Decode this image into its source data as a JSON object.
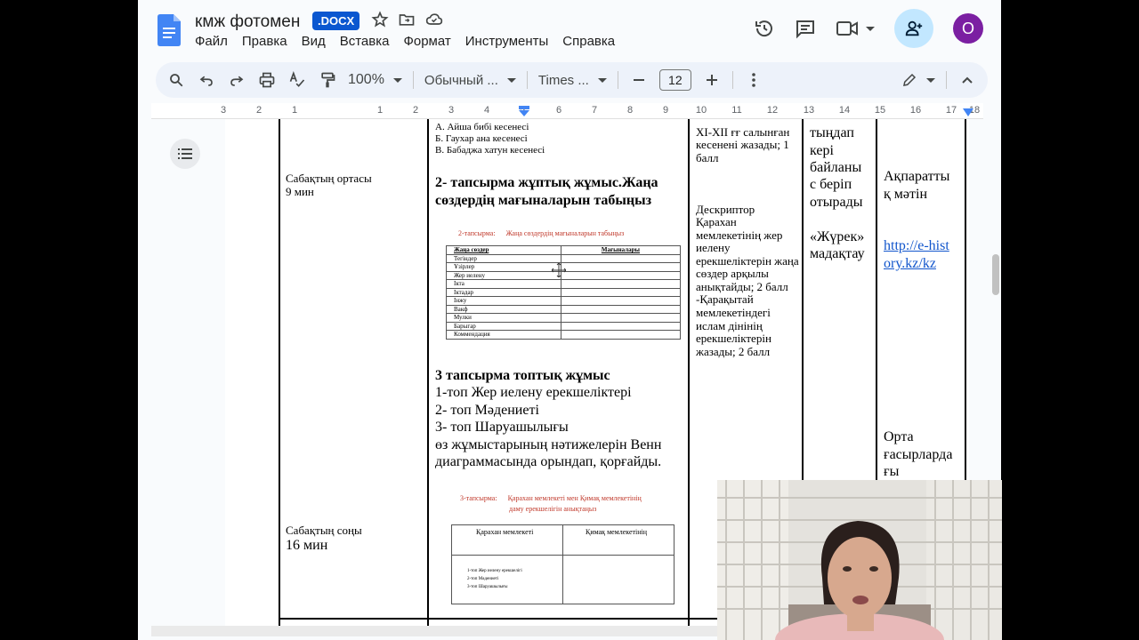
{
  "header": {
    "title": "кмж фотомен",
    "badge": ".DOCX"
  },
  "menu": [
    "Файл",
    "Правка",
    "Вид",
    "Вставка",
    "Формат",
    "Инструменты",
    "Справка"
  ],
  "toolbar": {
    "zoom": "100%",
    "style": "Обычный ...",
    "font": "Times ...",
    "font_size": "12"
  },
  "ruler": [
    "3",
    "2",
    "1",
    "1",
    "2",
    "3",
    "4",
    "5",
    "6",
    "7",
    "8",
    "9",
    "10",
    "11",
    "12",
    "13",
    "14",
    "15",
    "16",
    "17",
    "18"
  ],
  "avatar_letter": "O",
  "doc": {
    "col1": {
      "mid_label": "Сабақтың ортасы",
      "mid_time": "9 мин",
      "end_label": "Сабақтың соңы",
      "end_time": "16 мин"
    },
    "col2": {
      "opt_a": "А. Айша бибі кесенесі",
      "opt_b": "Б. Гаухар ана кесенесі",
      "opt_c": "В. Бабаджа хатун кесенесі",
      "task2_line1": "2- тапсырма жұптық жұмыс.Жаңа",
      "task2_line2": "сөздердің мағыналарын табыңыз",
      "mini_caption_label": "2-тапсырма:",
      "mini_caption_text": "Жаңа сөздердің мағыналарын табыңыз",
      "mini_table_headers": [
        "Жаңа сөздер",
        "Мағыналары"
      ],
      "mini_table_rows": [
        "Тегіндер",
        "Ұзірлер",
        "Жер иелену",
        "Iкта",
        "Iктадар",
        "Iнжу",
        "Вакф",
        "Мулки",
        "Барыгар",
        "Коммендация"
      ],
      "task3_title": "3 тапсырма топтық жұмыс",
      "task3_lines": [
        "1-топ Жер иелену ерекшеліктері",
        "2- топ Мәдениеті",
        "3- топ Шаруашылығы",
        "өз жұмыстарының нәтижелерін Венн",
        "диаграммасында орындап, қорғайды."
      ],
      "venn_caption_label": "3-тапсырма:",
      "venn_caption_line1": "Қарахан мемлекеті мен Қимақ мемлекетінің",
      "venn_caption_line2": "даму ерекшелігін анықтаңыз",
      "venn_left": "Қарахан мемлекеті",
      "venn_right": "Қимақ мемлекетінің",
      "venn_items": [
        "1-топ Жер иелену ерекшелігі",
        "2-топ Мәдениеті",
        "3-топ Шаруашылығы"
      ]
    },
    "col3": {
      "top_line1": "XI-XII ғғ салынған",
      "top_line2": "кесенені жазады; 1",
      "top_line3": "балл",
      "desc_lines": [
        "Дескриптор",
        "Қарахан",
        "мемлекетінің жер",
        "иелену",
        "ерекшеліктерін жаңа",
        "сөздер арқылы",
        "анықтайды; 2 балл",
        "-Қарақытай",
        "мемлекетіндегі",
        "ислам дінінің",
        "ерекшеліктерін",
        "жазады; 2 балл"
      ]
    },
    "col4": {
      "lines": [
        "тыңдап",
        "кері",
        "байланы",
        "с беріп",
        "отырады"
      ],
      "heart": "«Жүрек»",
      "heart2": "мадақтау"
    },
    "col5": {
      "info1": "Ақпаратты",
      "info2": "қ мәтін",
      "link1": "http://e-hist",
      "link2": "ory.kz/kz",
      "bottom1": "Орта",
      "bottom2": "ғасырларда",
      "bottom3": "ғы"
    }
  }
}
